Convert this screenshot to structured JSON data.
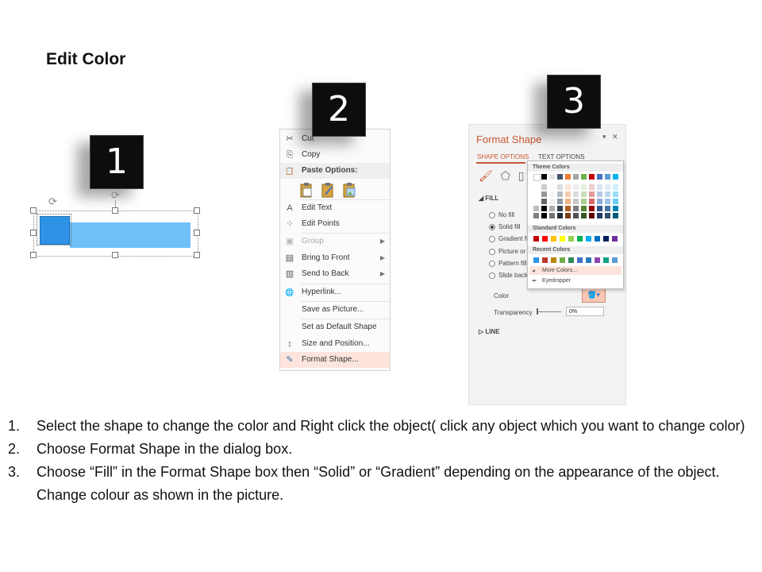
{
  "page": {
    "title": "Edit Color"
  },
  "badges": [
    "1",
    "2",
    "3"
  ],
  "context_menu": {
    "items": [
      {
        "label": "Cut",
        "icon": "scissors-icon",
        "glyph": "✂"
      },
      {
        "label": "Copy",
        "icon": "copy-icon",
        "glyph": "⎘"
      },
      {
        "label": "Paste Options:",
        "icon": "paste-icon",
        "glyph": "📋"
      },
      {
        "label": "Edit Text",
        "icon": "edit-text-icon",
        "glyph": "A"
      },
      {
        "label": "Edit Points",
        "icon": "edit-points-icon",
        "glyph": "⁘"
      },
      {
        "label": "Group",
        "icon": "group-icon",
        "glyph": "▣"
      },
      {
        "label": "Bring to Front",
        "icon": "bring-front-icon",
        "glyph": "▤"
      },
      {
        "label": "Send to Back",
        "icon": "send-back-icon",
        "glyph": "▥"
      },
      {
        "label": "Hyperlink...",
        "icon": "hyperlink-icon",
        "glyph": "🌐"
      },
      {
        "label": "Save as Picture...",
        "icon": "",
        "glyph": ""
      },
      {
        "label": "Set as Default Shape",
        "icon": "",
        "glyph": ""
      },
      {
        "label": "Size and Position...",
        "icon": "size-position-icon",
        "glyph": "↕"
      },
      {
        "label": "Format Shape...",
        "icon": "format-shape-icon",
        "glyph": "✎"
      }
    ]
  },
  "format_pane": {
    "title": "Format Shape",
    "close_glyph": "✕",
    "dropdown_glyph": "▾",
    "tabs": [
      "SHAPE OPTIONS",
      "TEXT OPTIONS"
    ],
    "fill_section": "FILL",
    "line_section": "LINE",
    "fill_options": [
      "No fill",
      "Solid fill",
      "Gradient fill",
      "Picture or texture fill",
      "Pattern fill",
      "Slide background fill"
    ],
    "color_label": "Color",
    "transparency_label": "Transparency",
    "transparency_value": "0%"
  },
  "color_dropdown": {
    "theme_header": "Theme Colors",
    "standard_header": "Standard Colors",
    "recent_header": "Recent Colors",
    "more_colors": "More Colors...",
    "eyedropper": "Eyedropper",
    "theme_top": [
      "#ffffff",
      "#000000",
      "#e7e6e6",
      "#44546a",
      "#ed7d31",
      "#a5a5a5",
      "#70ad47",
      "#c00000",
      "#4472c4",
      "#5b9bd5",
      "#00b0f0"
    ],
    "standard": [
      "#c00000",
      "#ff0000",
      "#ffc000",
      "#ffff00",
      "#92d050",
      "#00b050",
      "#00b0f0",
      "#0070c0",
      "#002060",
      "#7030a0"
    ],
    "recent": [
      "#2e93e5",
      "#c0392b",
      "#b8860b",
      "#70ad47",
      "#2e8b57",
      "#4472c4",
      "#2b7bb9",
      "#8e44ad",
      "#16a085",
      "#5b9bd5"
    ]
  },
  "instructions": [
    "Select the shape to change the color and Right click the object( click any object which you want to change color)",
    "Choose Format Shape in the dialog box.",
    "Choose “Fill” in the Format Shape box then “Solid” or “Gradient” depending on the appearance of the object. Change colour as shown in the picture."
  ],
  "instruction_numbers": [
    "1.",
    "2.",
    "3."
  ]
}
